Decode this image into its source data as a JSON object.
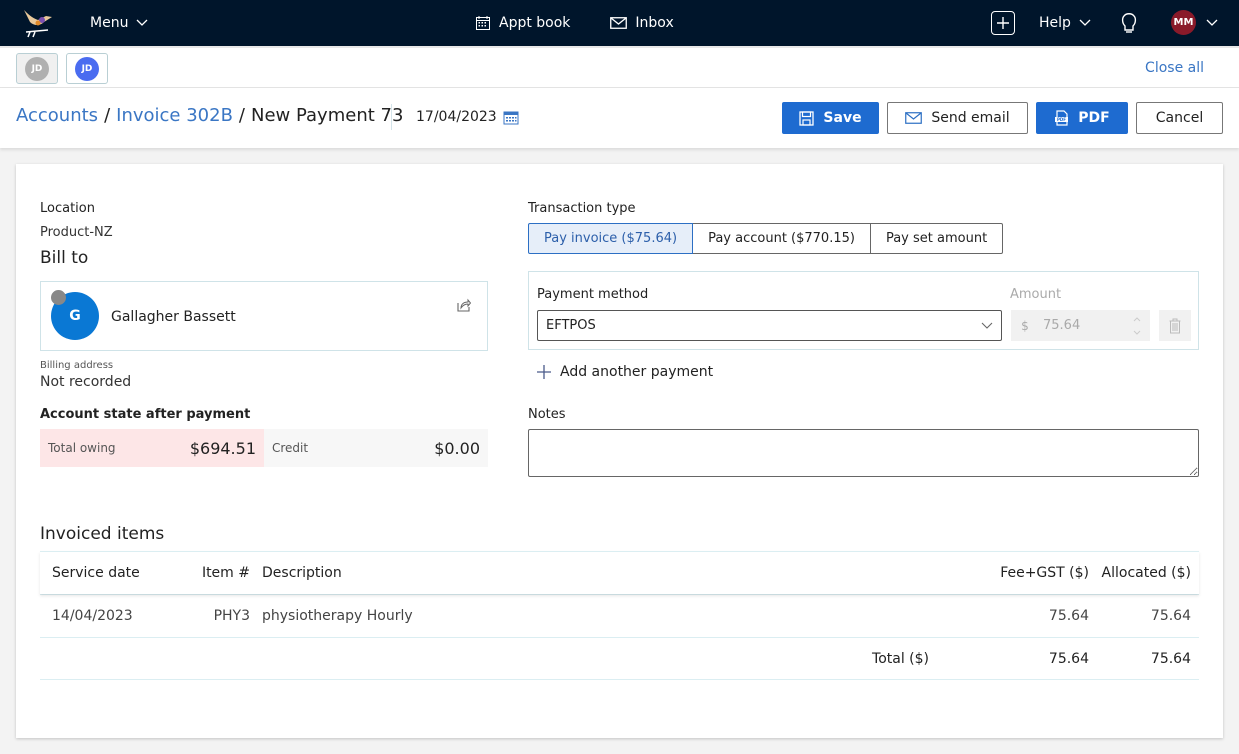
{
  "topnav": {
    "menu_label": "Menu",
    "appt_book_label": "Appt book",
    "inbox_label": "Inbox",
    "help_label": "Help",
    "user_initials": "MM"
  },
  "tabs": {
    "items": [
      {
        "initials": "JD",
        "color": "#b0b0b0",
        "active": false
      },
      {
        "initials": "JD",
        "color": "#4a6cf0",
        "active": true
      }
    ],
    "close_all_label": "Close all"
  },
  "header": {
    "breadcrumb": [
      "Accounts",
      "Invoice 302B",
      "New Payment 73"
    ],
    "separator": "/",
    "date": "17/04/2023",
    "save_label": "Save",
    "send_email_label": "Send email",
    "pdf_label": "PDF",
    "cancel_label": "Cancel"
  },
  "form": {
    "location_label": "Location",
    "location_value": "Product-NZ",
    "bill_to_label": "Bill to",
    "bill_to": {
      "initial": "G",
      "name": "Gallagher Bassett"
    },
    "billing_address_label": "Billing address",
    "billing_address_value": "Not recorded",
    "account_state_label": "Account state after payment",
    "total_owing_label": "Total owing",
    "total_owing_value": "$694.51",
    "credit_label": "Credit",
    "credit_value": "$0.00",
    "transaction_type_label": "Transaction type",
    "transaction_types": [
      "Pay invoice ($75.64)",
      "Pay account ($770.15)",
      "Pay set amount"
    ],
    "selected_transaction_type": "Pay invoice ($75.64)",
    "payment_method_label": "Payment method",
    "payment_method_value": "EFTPOS",
    "amount_label": "Amount",
    "amount_currency": "$",
    "amount_value": "75.64",
    "add_payment_label": "Add another payment",
    "notes_label": "Notes",
    "notes_value": ""
  },
  "invoiced": {
    "title": "Invoiced items",
    "columns": [
      "Service date",
      "Item #",
      "Description",
      "Fee+GST ($)",
      "Allocated ($)"
    ],
    "rows": [
      {
        "service_date": "14/04/2023",
        "item": "PHY3",
        "description": "physiotherapy Hourly",
        "fee": "75.64",
        "allocated": "75.64"
      }
    ],
    "total_label": "Total ($)",
    "total_fee": "75.64",
    "total_allocated": "75.64"
  }
}
